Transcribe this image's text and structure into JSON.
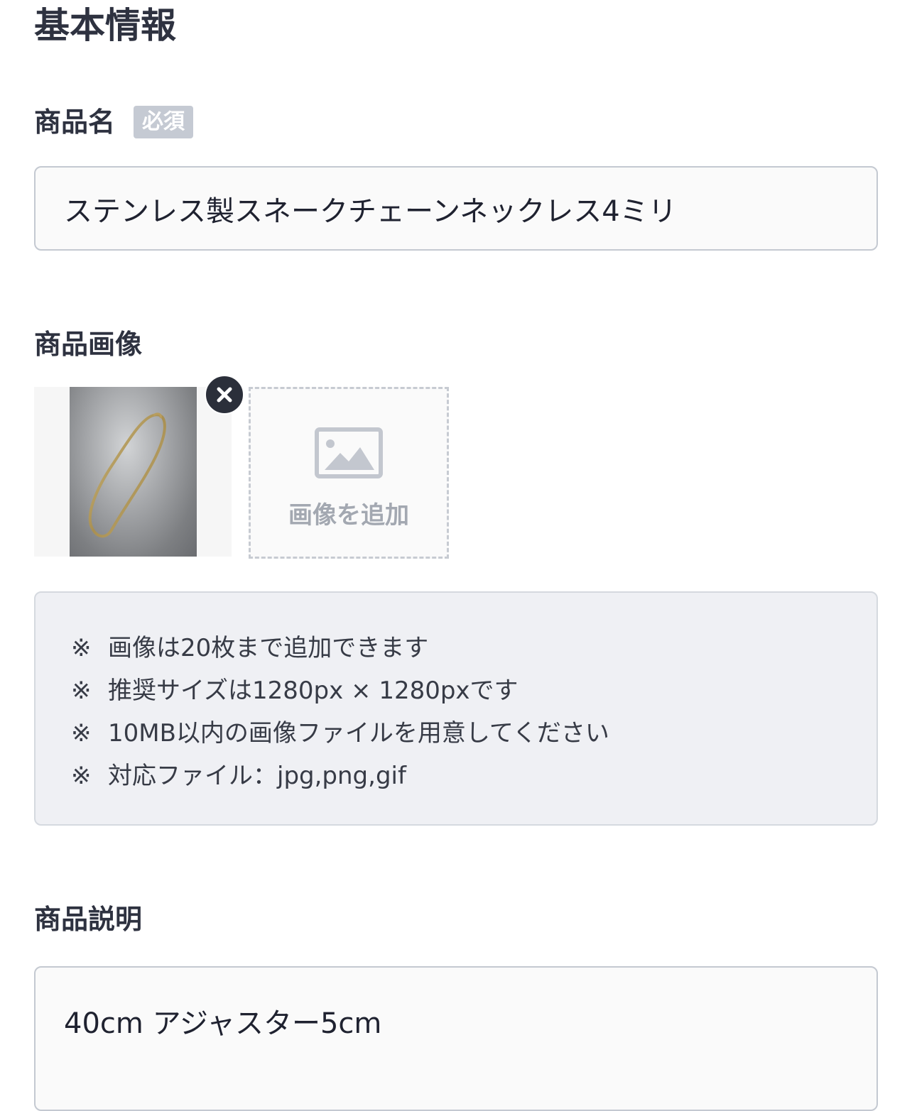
{
  "section": {
    "title": "基本情報"
  },
  "product_name": {
    "label": "商品名",
    "required_badge": "必須",
    "value": "ステンレス製スネークチェーンネックレス4ミリ"
  },
  "product_image": {
    "label": "商品画像",
    "remove_icon": "close-icon",
    "add_label": "画像を追加",
    "add_icon": "image-icon"
  },
  "notes": {
    "mark": "※",
    "items": [
      "画像は20枚まで追加できます",
      "推奨サイズは1280px × 1280pxです",
      "10MB以内の画像ファイルを用意してください",
      "対応ファイル：jpg,png,gif"
    ]
  },
  "product_description": {
    "label": "商品説明",
    "value": "40cm アジャスター5cm"
  },
  "colors": {
    "text": "#2e3240",
    "badge": "#c5cad3",
    "notes_bg": "#eff0f4",
    "border": "#c4c9d1"
  }
}
